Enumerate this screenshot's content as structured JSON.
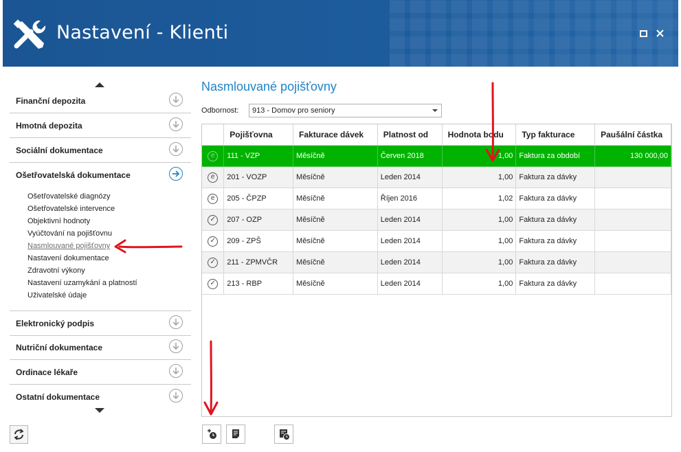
{
  "window": {
    "title": "Nastavení - Klienti",
    "icon": "tools-icon",
    "header_color": "#1d5a9a"
  },
  "nav": {
    "sections_top": [
      {
        "label": "Finanční depozita",
        "icon": "arrow-down-circle-icon"
      },
      {
        "label": "Hmotná depozita",
        "icon": "arrow-down-circle-icon"
      },
      {
        "label": "Sociální dokumentace",
        "icon": "arrow-down-circle-icon"
      },
      {
        "label": "Ošetřovatelská dokumentace",
        "icon": "arrow-right-circle-icon",
        "active": true
      }
    ],
    "sub_items": [
      {
        "label": "Ošetřovatelské diagnózy"
      },
      {
        "label": "Ošetřovatelské intervence"
      },
      {
        "label": "Objektivní hodnoty"
      },
      {
        "label": "Vyúčtování na pojišťovnu"
      },
      {
        "label": "Nasmlouvané pojišťovny",
        "selected": true
      },
      {
        "label": "Nastavení dokumentace"
      },
      {
        "label": "Zdravotní výkony"
      },
      {
        "label": "Nastavení uzamykání a platností"
      },
      {
        "label": "Uživatelské údaje"
      }
    ],
    "sections_bottom": [
      {
        "label": "Elektronický podpis",
        "icon": "arrow-down-circle-icon"
      },
      {
        "label": "Nutriční dokumentace",
        "icon": "arrow-down-circle-icon"
      },
      {
        "label": "Ordinace lékaře",
        "icon": "arrow-down-circle-icon"
      },
      {
        "label": "Ostatní dokumentace",
        "icon": "arrow-down-circle-icon"
      }
    ]
  },
  "main": {
    "title": "Nasmlouvané pojišťovny",
    "filter": {
      "label": "Odbornost:",
      "value": "913 - Domov pro seniory"
    },
    "table": {
      "columns": [
        "",
        "Pojišťovna",
        "Fakturace dávek",
        "Platnost od",
        "Hodnota bodu",
        "Typ fakturace",
        "Paušální částka"
      ],
      "rows": [
        {
          "status": "e",
          "pojistovna": "111 - VZP",
          "fakturace": "Měsíčně",
          "platnost": "Červen 2018",
          "hodnota": "1,00",
          "typ": "Faktura za období",
          "pausal": "130 000,00",
          "selected": true
        },
        {
          "status": "e",
          "pojistovna": "201 - VOZP",
          "fakturace": "Měsíčně",
          "platnost": "Leden 2014",
          "hodnota": "1,00",
          "typ": "Faktura za dávky",
          "pausal": ""
        },
        {
          "status": "e",
          "pojistovna": "205 - ČPZP",
          "fakturace": "Měsíčně",
          "platnost": "Říjen 2016",
          "hodnota": "1,02",
          "typ": "Faktura za dávky",
          "pausal": ""
        },
        {
          "status": "check",
          "pojistovna": "207 - OZP",
          "fakturace": "Měsíčně",
          "platnost": "Leden 2014",
          "hodnota": "1,00",
          "typ": "Faktura za dávky",
          "pausal": ""
        },
        {
          "status": "check",
          "pojistovna": "209 - ZPŠ",
          "fakturace": "Měsíčně",
          "platnost": "Leden 2014",
          "hodnota": "1,00",
          "typ": "Faktura za dávky",
          "pausal": ""
        },
        {
          "status": "check",
          "pojistovna": "211 - ZPMVČR",
          "fakturace": "Měsíčně",
          "platnost": "Leden 2014",
          "hodnota": "1,00",
          "typ": "Faktura za dávky",
          "pausal": ""
        },
        {
          "status": "check",
          "pojistovna": "213 - RBP",
          "fakturace": "Měsíčně",
          "platnost": "Leden 2014",
          "hodnota": "1,00",
          "typ": "Faktura za dávky",
          "pausal": ""
        }
      ]
    }
  },
  "toolbar": {
    "buttons": [
      {
        "icon": "add-clock-icon"
      },
      {
        "icon": "document-icon"
      },
      {
        "icon": "calendar-clock-icon"
      }
    ],
    "refresh_icon": "refresh-icon"
  },
  "colors": {
    "accent": "#1f84c7",
    "selected_row": "#00b300",
    "annotation_arrow": "#e0141e"
  }
}
